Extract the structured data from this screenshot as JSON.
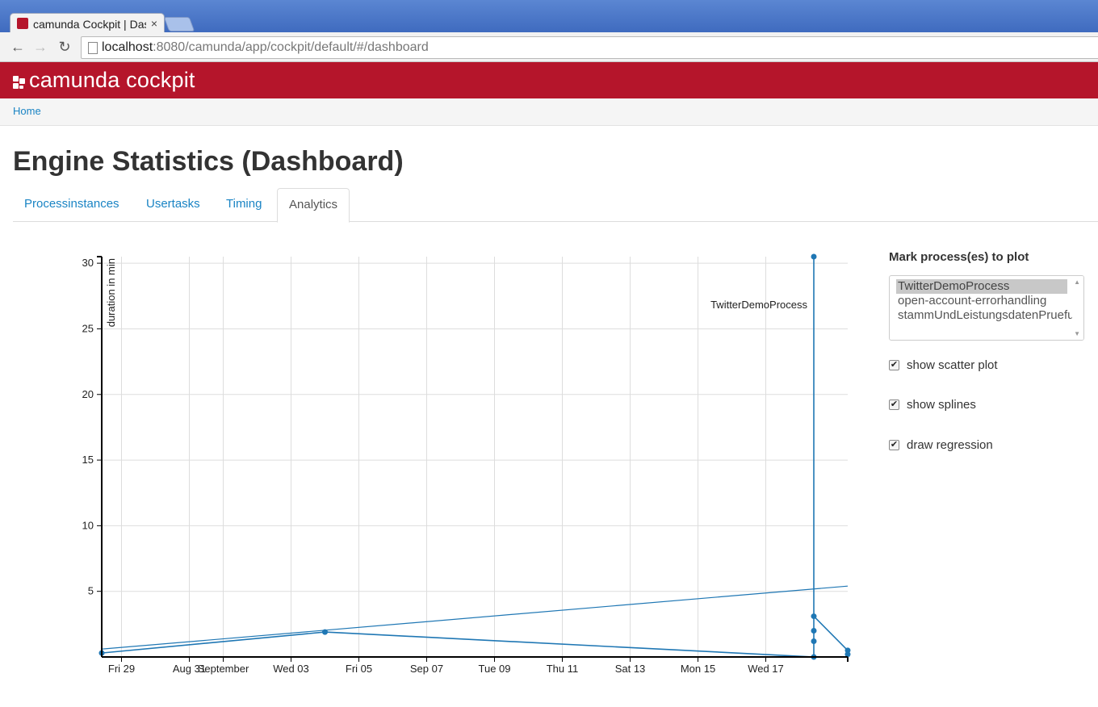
{
  "browser": {
    "tab_title": "camunda Cockpit | Dashboard",
    "url_host": "localhost",
    "url_rest": ":8080/camunda/app/cockpit/default/#/dashboard",
    "close_glyph": "×"
  },
  "app": {
    "brand": "camunda cockpit",
    "brand_color": "#b5152b"
  },
  "breadcrumb": {
    "home": "Home"
  },
  "page": {
    "title": "Engine Statistics (Dashboard)"
  },
  "tabs": [
    {
      "label": "Processinstances",
      "active": false
    },
    {
      "label": "Usertasks",
      "active": false
    },
    {
      "label": "Timing",
      "active": false
    },
    {
      "label": "Analytics",
      "active": true
    }
  ],
  "panel": {
    "title": "Mark process(es) to plot",
    "processes": [
      {
        "label": "TwitterDemoProcess",
        "selected": true
      },
      {
        "label": "open-account-errorhandling",
        "selected": false
      },
      {
        "label": "stammUndLeistungsdatenPruefung",
        "selected": false
      }
    ],
    "options": [
      {
        "label": "show scatter plot",
        "checked": true
      },
      {
        "label": "show splines",
        "checked": true
      },
      {
        "label": "draw regression",
        "checked": true
      }
    ]
  },
  "chart_data": {
    "type": "scatter",
    "ylabel": "duration in min",
    "y_ticks": [
      5,
      10,
      15,
      20,
      25,
      30
    ],
    "x_ticks": [
      {
        "date": "2014-08-29",
        "label": "Fri 29"
      },
      {
        "date": "2014-08-31",
        "label": "Aug 31"
      },
      {
        "date": "2014-09-01",
        "label": "September"
      },
      {
        "date": "2014-09-03",
        "label": "Wed 03"
      },
      {
        "date": "2014-09-05",
        "label": "Fri 05"
      },
      {
        "date": "2014-09-07",
        "label": "Sep 07"
      },
      {
        "date": "2014-09-09",
        "label": "Tue 09"
      },
      {
        "date": "2014-09-11",
        "label": "Thu 11"
      },
      {
        "date": "2014-09-13",
        "label": "Sat 13"
      },
      {
        "date": "2014-09-15",
        "label": "Mon 15"
      },
      {
        "date": "2014-09-17",
        "label": "Wed 17"
      }
    ],
    "xlim": [
      "2014-08-28 10:00",
      "2014-09-19 10:00"
    ],
    "ylim": [
      0,
      30.5
    ],
    "grid": true,
    "series_label": "TwitterDemoProcess",
    "series": [
      {
        "name": "TwitterDemoProcess",
        "color": "#1f77b4",
        "points": [
          {
            "x": "2014-08-28 10:00",
            "y": 0.3
          },
          {
            "x": "2014-09-04 00:00",
            "y": 1.9
          },
          {
            "x": "2014-09-18 10:00",
            "y": 0.0
          },
          {
            "x": "2014-09-18 10:00",
            "y": 1.2
          },
          {
            "x": "2014-09-18 10:00",
            "y": 2.0
          },
          {
            "x": "2014-09-18 10:00",
            "y": 3.1
          },
          {
            "x": "2014-09-18 10:00",
            "y": 30.5
          },
          {
            "x": "2014-09-19 10:00",
            "y": 0.5
          },
          {
            "x": "2014-09-19 10:00",
            "y": 0.2
          }
        ],
        "spline_order": [
          0,
          1,
          2,
          6,
          5,
          7
        ],
        "regression": {
          "y_start": 0.6,
          "y_end": 5.4
        }
      }
    ]
  }
}
